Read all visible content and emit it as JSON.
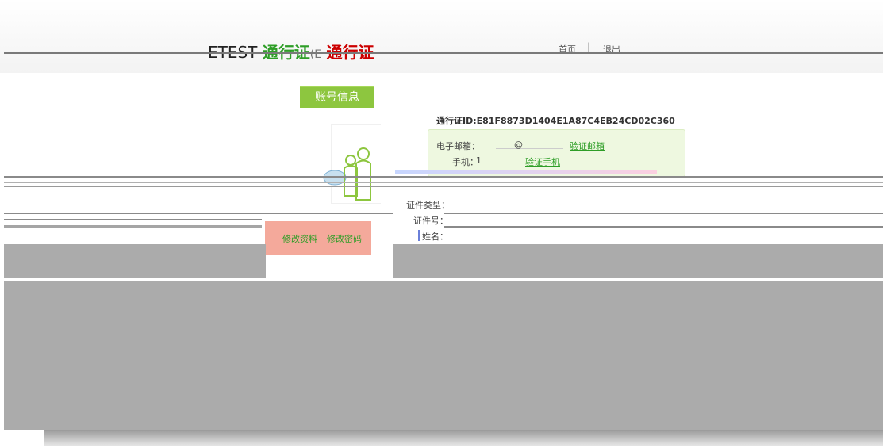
{
  "header": {
    "brand_prefix": "ETEST",
    "brand_green": "通行证",
    "brand_mid": "(E",
    "brand_red": "通行证",
    "nav": {
      "home": "首页",
      "logout": "退出"
    }
  },
  "sidebar": {
    "tab_label": "账号信息",
    "actions": {
      "edit_profile": "修改资料",
      "change_password": "修改密码"
    }
  },
  "account": {
    "pass_id_label": "通行证ID:",
    "pass_id_value": "E81F8873D1404E1A87C4EB24CD02C360",
    "email_label": "电子邮箱：",
    "email_value": "@",
    "email_verify": "验证邮箱",
    "phone_label": "手机：",
    "phone_value": "1",
    "phone_verify": "验证手机",
    "id_type_label": "证件类型：",
    "id_number_label": "证件号：",
    "name_label": "姓名："
  },
  "colors": {
    "accent_green": "#8dc63f",
    "link_green": "#2e9e27",
    "brand_red": "#cc0000",
    "panel_bg": "#eef8e0",
    "salmon": "#f4a99b"
  },
  "icons": {
    "avatar": "user-silhouette-icon"
  }
}
